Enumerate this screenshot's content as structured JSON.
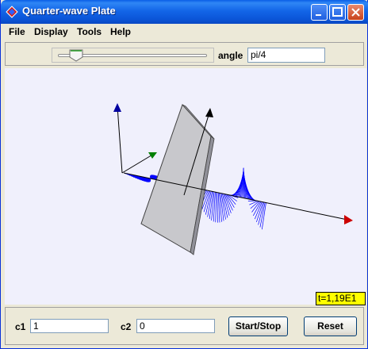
{
  "window": {
    "title": "Quarter-wave Plate"
  },
  "menu": [
    "File",
    "Display",
    "Tools",
    "Help"
  ],
  "controls": {
    "angle_label": "angle",
    "angle_value": "pi/4",
    "slider_fraction": 0.12
  },
  "readout": {
    "time": "t=1,19E1"
  },
  "bottom": {
    "c1_label": "c1",
    "c1_value": "1",
    "c2_label": "c2",
    "c2_value": "0",
    "start_stop_label": "Start/Stop",
    "reset_label": "Reset"
  },
  "colors": {
    "wave": "#0000ff",
    "axis_x": "#cc0000",
    "axis_y": "#008000",
    "axis_z": "#000080",
    "plate": "#c4c4c8",
    "badge": "#ffff00"
  }
}
